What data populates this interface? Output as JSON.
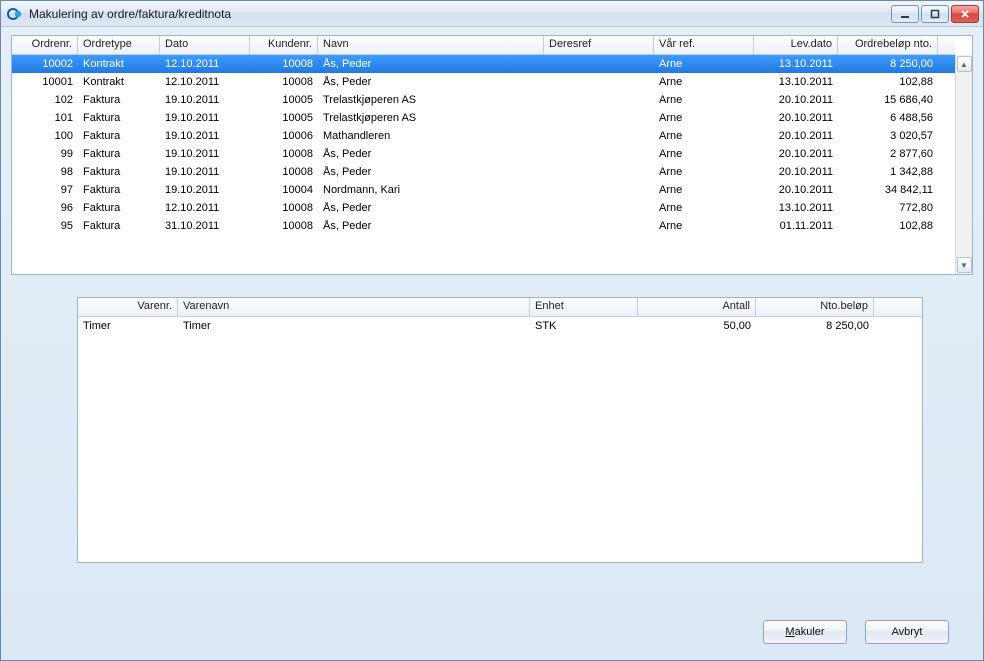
{
  "window": {
    "title": "Makulering av ordre/faktura/kreditnota"
  },
  "topGrid": {
    "headers": {
      "ordrenr": "Ordrenr.",
      "ordretype": "Ordretype",
      "dato": "Dato",
      "kundenr": "Kundenr.",
      "navn": "Navn",
      "deresref": "Deresref",
      "varref": "Vår ref.",
      "levdato": "Lev.dato",
      "belop": "Ordrebeløp nto."
    },
    "rows": [
      {
        "ordrenr": "10002",
        "ordretype": "Kontrakt",
        "dato": "12.10.2011",
        "kundenr": "10008",
        "navn": "Ås, Peder",
        "deresref": "",
        "varref": "Arne",
        "levdato": "13.10.2011",
        "belop": "8 250,00",
        "selected": true
      },
      {
        "ordrenr": "10001",
        "ordretype": "Kontrakt",
        "dato": "12.10.2011",
        "kundenr": "10008",
        "navn": "Ås, Peder",
        "deresref": "",
        "varref": "Arne",
        "levdato": "13.10.2011",
        "belop": "102,88"
      },
      {
        "ordrenr": "102",
        "ordretype": "Faktura",
        "dato": "19.10.2011",
        "kundenr": "10005",
        "navn": "Trelastkjøperen AS",
        "deresref": "",
        "varref": "Arne",
        "levdato": "20.10.2011",
        "belop": "15 686,40"
      },
      {
        "ordrenr": "101",
        "ordretype": "Faktura",
        "dato": "19.10.2011",
        "kundenr": "10005",
        "navn": "Trelastkjøperen AS",
        "deresref": "",
        "varref": "Arne",
        "levdato": "20.10.2011",
        "belop": "6 488,56"
      },
      {
        "ordrenr": "100",
        "ordretype": "Faktura",
        "dato": "19.10.2011",
        "kundenr": "10006",
        "navn": "Mathandleren",
        "deresref": "",
        "varref": "Arne",
        "levdato": "20.10.2011",
        "belop": "3 020,57"
      },
      {
        "ordrenr": "99",
        "ordretype": "Faktura",
        "dato": "19.10.2011",
        "kundenr": "10008",
        "navn": "Ås, Peder",
        "deresref": "",
        "varref": "Arne",
        "levdato": "20.10.2011",
        "belop": "2 877,60"
      },
      {
        "ordrenr": "98",
        "ordretype": "Faktura",
        "dato": "19.10.2011",
        "kundenr": "10008",
        "navn": "Ås, Peder",
        "deresref": "",
        "varref": "Arne",
        "levdato": "20.10.2011",
        "belop": "1 342,88"
      },
      {
        "ordrenr": "97",
        "ordretype": "Faktura",
        "dato": "19.10.2011",
        "kundenr": "10004",
        "navn": "Nordmann, Kari",
        "deresref": "",
        "varref": "Arne",
        "levdato": "20.10.2011",
        "belop": "34 842,11"
      },
      {
        "ordrenr": "96",
        "ordretype": "Faktura",
        "dato": "12.10.2011",
        "kundenr": "10008",
        "navn": "Ås, Peder",
        "deresref": "",
        "varref": "Arne",
        "levdato": "13.10.2011",
        "belop": "772,80"
      },
      {
        "ordrenr": "95",
        "ordretype": "Faktura",
        "dato": "31.10.2011",
        "kundenr": "10008",
        "navn": "Ås, Peder",
        "deresref": "",
        "varref": "Arne",
        "levdato": "01.11.2011",
        "belop": "102,88"
      }
    ]
  },
  "detailGrid": {
    "headers": {
      "varenr": "Varenr.",
      "varenavn": "Varenavn",
      "enhet": "Enhet",
      "antall": "Antall",
      "ntobelop": "Nto.beløp"
    },
    "rows": [
      {
        "varenr": "Timer",
        "varenavn": "Timer",
        "enhet": "STK",
        "antall": "50,00",
        "ntobelop": "8 250,00"
      }
    ]
  },
  "buttons": {
    "makuler_prefix": "M",
    "makuler_rest": "akuler",
    "avbryt": "Avbryt"
  }
}
